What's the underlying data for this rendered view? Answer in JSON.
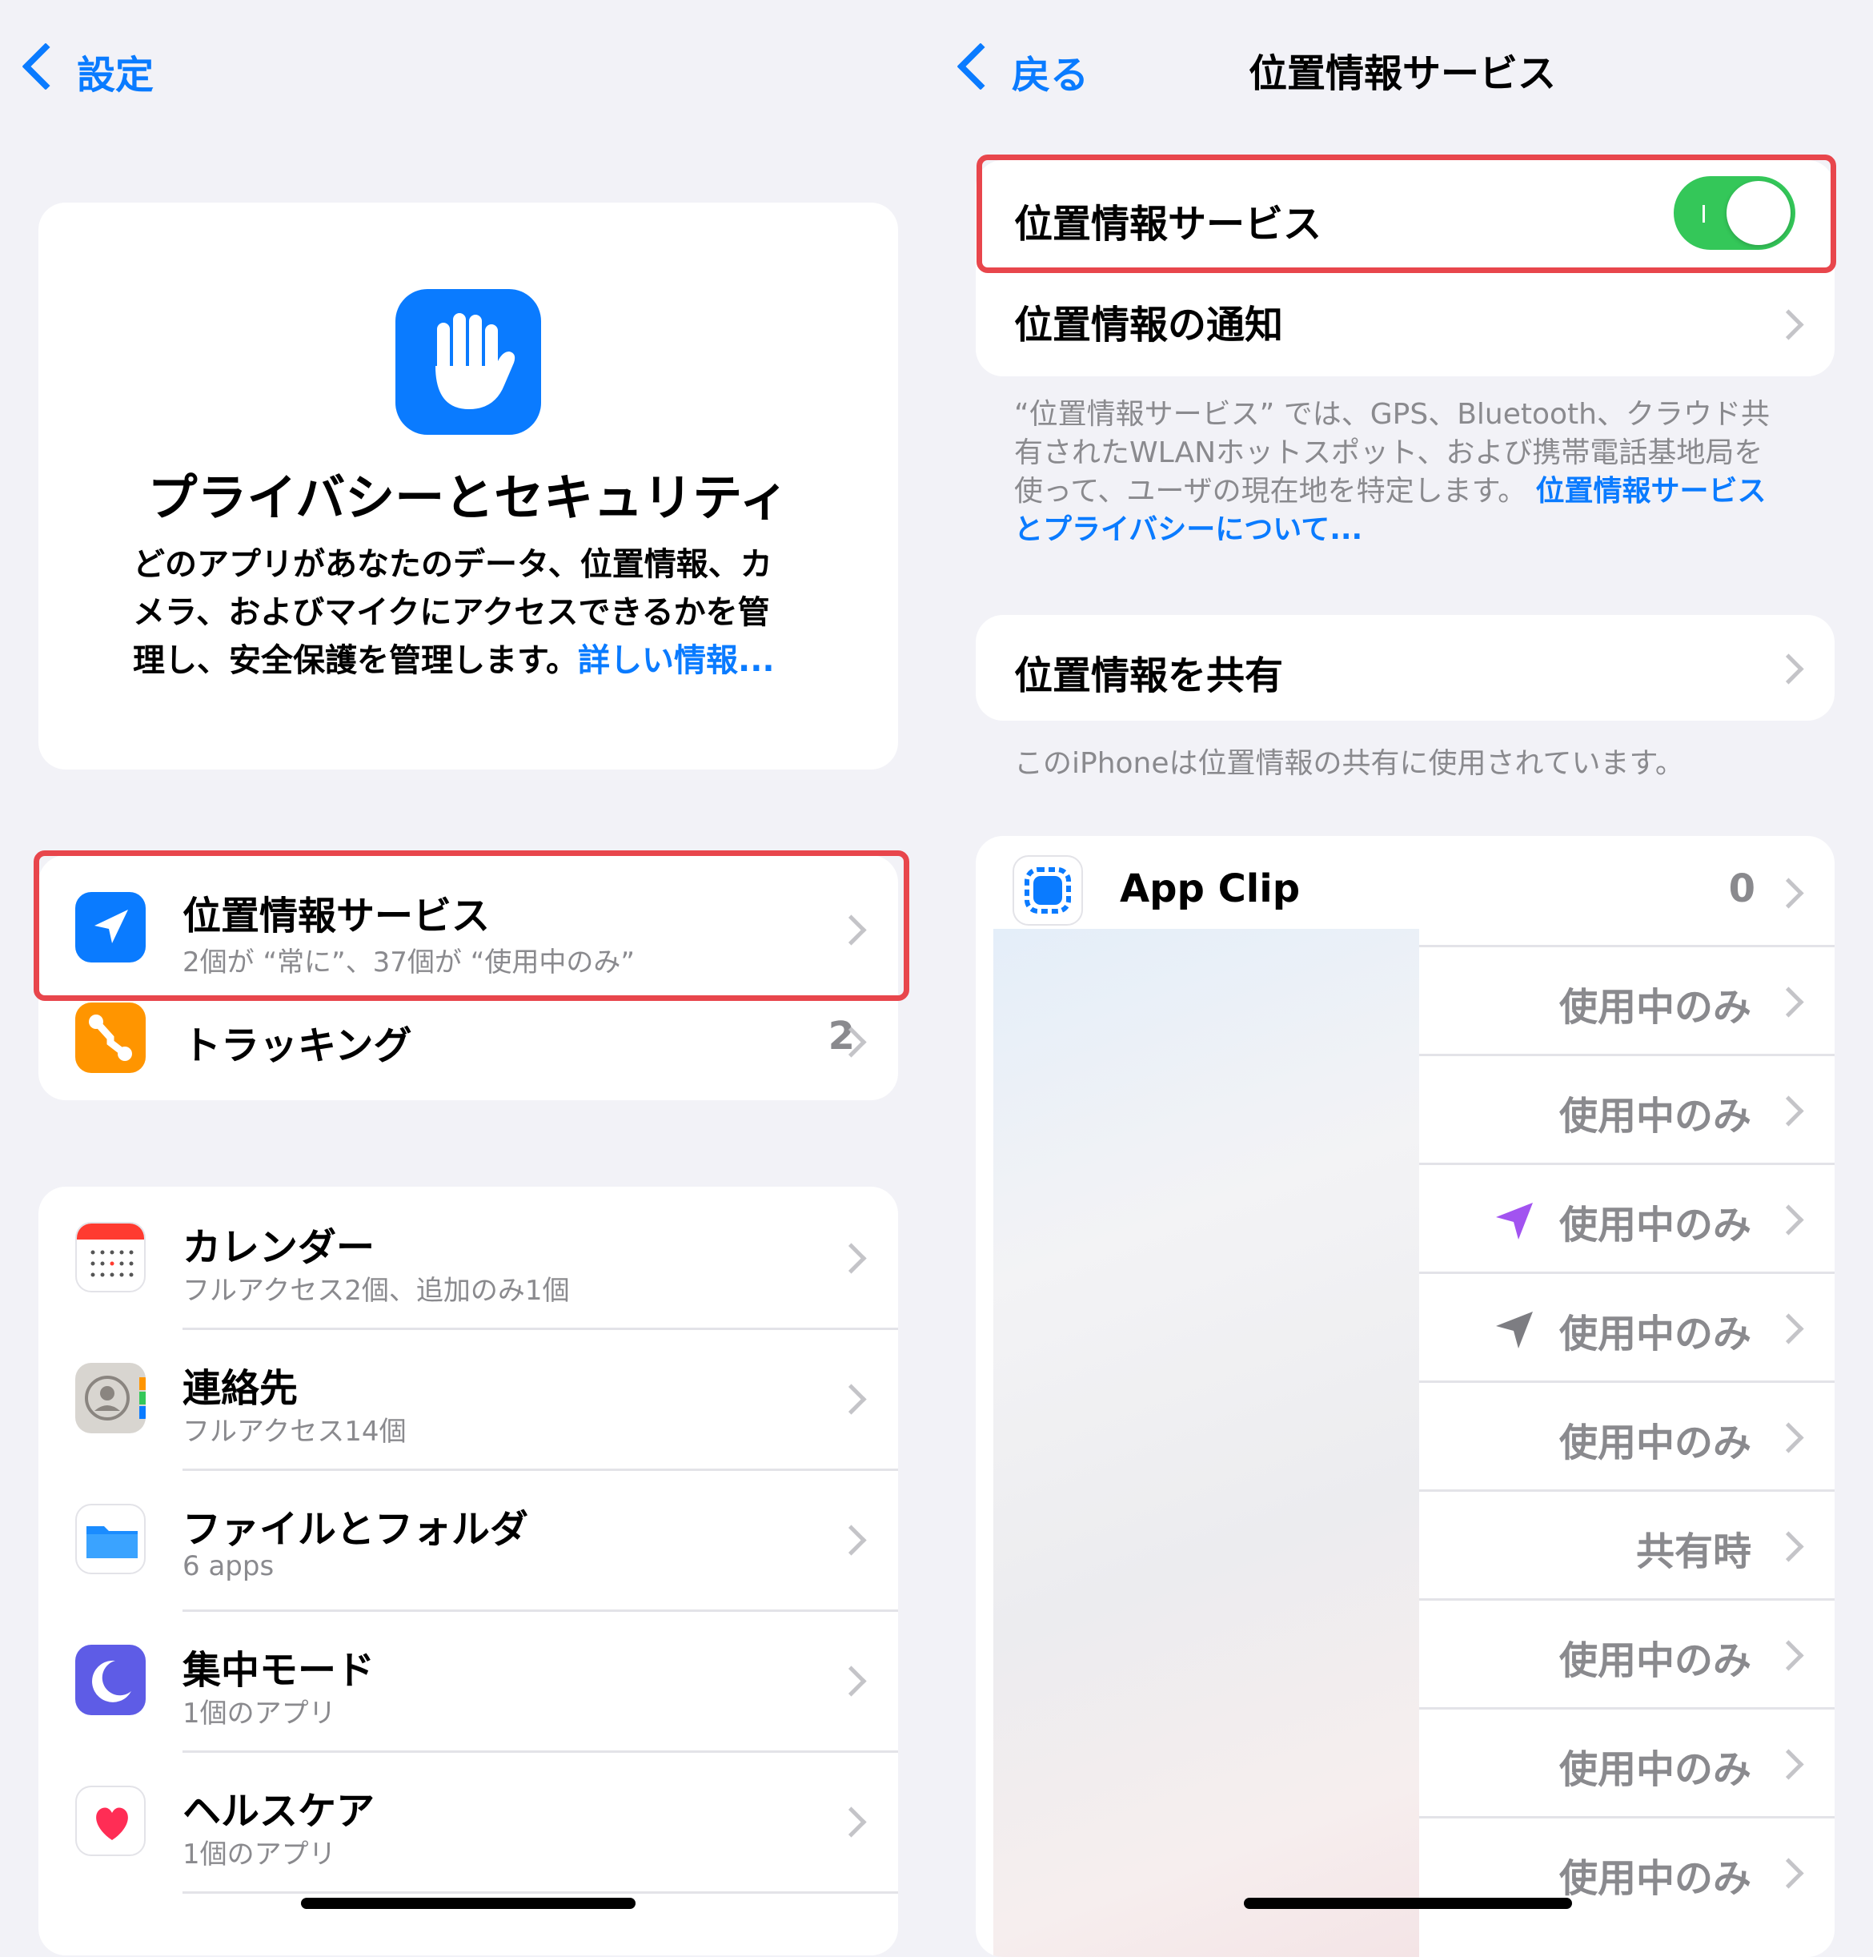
{
  "left": {
    "back_label": "設定",
    "hero": {
      "title": "プライバシーとセキュリティ",
      "line1": "どのアプリがあなたのデータ、位置情報、カ",
      "line2": "メラ、およびマイクにアクセスできるかを管",
      "line3": "理し、安全保護を管理します。",
      "link": "詳しい情報..."
    },
    "group1": [
      {
        "title": "位置情報サービス",
        "subtitle": "2個が “常に”、37個が “使用中のみ”"
      },
      {
        "title": "トラッキング",
        "value": "2"
      }
    ],
    "group2": [
      {
        "title": "カレンダー",
        "subtitle": "フルアクセス2個、追加のみ1個"
      },
      {
        "title": "連絡先",
        "subtitle": "フルアクセス14個"
      },
      {
        "title": "ファイルとフォルダ",
        "subtitle": "6 apps"
      },
      {
        "title": "集中モード",
        "subtitle": "1個のアプリ"
      },
      {
        "title": "ヘルスケア",
        "subtitle": "1個のアプリ"
      }
    ]
  },
  "right": {
    "back_label": "戻る",
    "nav_title": "位置情報サービス",
    "toggle_row": {
      "title": "位置情報サービス",
      "on": true
    },
    "notify_row": {
      "title": "位置情報の通知"
    },
    "description": {
      "line1": "“位置情報サービス” では、GPS、Bluetooth、クラウド共",
      "line2": "有されたWLANホットスポット、および携帯電話基地局を",
      "line3": "使って、ユーザの現在地を特定します。",
      "link1": "位置情報サービス",
      "link2": "とプライバシーについて..."
    },
    "share_row": {
      "title": "位置情報を共有"
    },
    "share_note": "このiPhoneは位置情報の共有に使用されています。",
    "app_clip": {
      "title": "App Clip",
      "value": "0"
    },
    "apps": [
      {
        "value": "使用中のみ"
      },
      {
        "value": "使用中のみ"
      },
      {
        "value": "使用中のみ",
        "arrow": "purple"
      },
      {
        "value": "使用中のみ",
        "arrow": "gray"
      },
      {
        "value": "使用中のみ"
      },
      {
        "value": "共有時"
      },
      {
        "value": "使用中のみ"
      },
      {
        "value": "使用中のみ"
      },
      {
        "value": "使用中のみ"
      }
    ]
  },
  "colors": {
    "accent": "#0a7bff",
    "toggle_on": "#34c759",
    "highlight": "#e8464c",
    "location_purple": "#a253f0"
  }
}
